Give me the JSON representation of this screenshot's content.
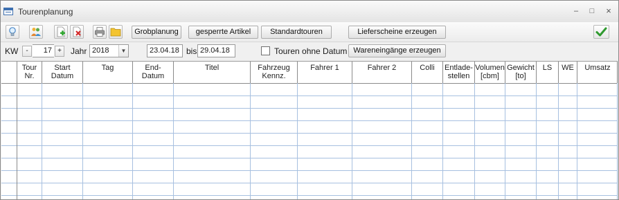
{
  "window": {
    "title": "Tourenplanung",
    "controls": {
      "minimize": "–",
      "maximize": "□",
      "close": "×"
    }
  },
  "toolbar": {
    "icons": [
      "lightbulb-icon",
      "people-icon",
      "add-document-icon",
      "delete-document-icon",
      "print-icon",
      "folder-icon"
    ],
    "grobplanung": "Grobplanung",
    "gesperrte_artikel": "gesperrte Artikel",
    "standardtouren": "Standardtouren",
    "lieferscheine": "Lieferscheine erzeugen",
    "confirm_icon": "checkmark-icon"
  },
  "filter": {
    "kw_label": "KW",
    "kw_minus": "-",
    "kw_value": "17",
    "kw_plus": "+",
    "jahr_label": "Jahr",
    "jahr_value": "2018",
    "date_from": "23.04.18",
    "bis_label": "bis",
    "date_to": "29.04.18",
    "touren_ohne_datum": "Touren ohne Datum",
    "wareneingaenge": "Wareneingänge erzeugen"
  },
  "grid": {
    "columns": [
      "Tour\nNr.",
      "Start\nDatum",
      "Tag",
      "End-\nDatum",
      "Titel",
      "Fahrzeug\nKennz.",
      "Fahrer 1",
      "Fahrer 2",
      "Colli",
      "Entlade-\nstellen",
      "Volumen\n[cbm]",
      "Gewicht\n[to]",
      "LS",
      "WE",
      "Umsatz"
    ],
    "row_count": 10
  },
  "colors": {
    "grid_line": "#a7c0e0",
    "grid_border": "#8a8a8a",
    "accent": "#3d6fb0"
  }
}
